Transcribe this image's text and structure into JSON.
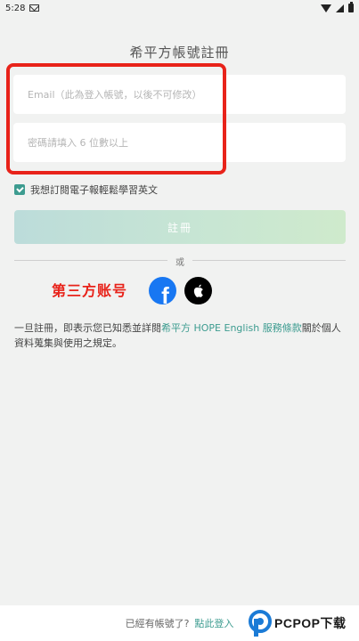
{
  "status_bar": {
    "time": "5:28"
  },
  "page_title": "希平方帳號註冊",
  "form": {
    "email_placeholder": "Email（此為登入帳號，以後不可修改）",
    "password_placeholder": "密碼請填入 6 位數以上"
  },
  "newsletter": {
    "label": "我想訂閱電子報輕鬆學習英文",
    "checked": true
  },
  "signup_button_label": "註冊",
  "divider_text": "或",
  "annotation_label": "第三方账号",
  "social": {
    "facebook_icon": "facebook-icon",
    "apple_icon": "apple-icon"
  },
  "terms": {
    "prefix": "一旦註冊，即表示您已知悉並詳閱",
    "link": "希平方 HOPE English 服務條款",
    "suffix": "關於個人資料蒐集與使用之規定。"
  },
  "bottom": {
    "question": "已經有帳號了?",
    "login_link": "點此登入"
  },
  "watermark": {
    "text": "PCPOP下载"
  },
  "colors": {
    "accent": "#3d9c90",
    "highlight": "#e8231a",
    "facebook": "#1877f2"
  }
}
